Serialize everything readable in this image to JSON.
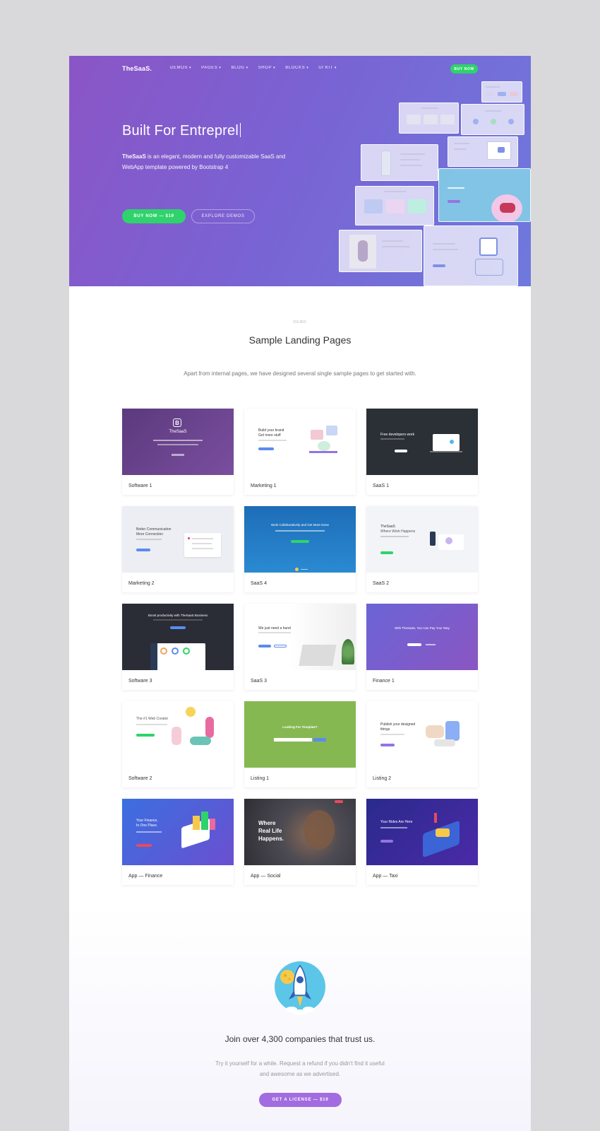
{
  "header": {
    "logo": "TheSaaS.",
    "nav": [
      "DEMOS",
      "PAGES",
      "BLOG",
      "SHOP",
      "BLOCKS",
      "UI KIT"
    ],
    "buy_label": "BUY NOW"
  },
  "hero": {
    "title": "Built For  Entreprel",
    "brand": "TheSaaS",
    "description": " is an elegant, modern and fully customizable SaaS and WebApp template powered by Bootstrap 4",
    "buy_button": "BUY NOW — $19",
    "explore_button": "EXPLORE DEMOS"
  },
  "section": {
    "eyebrow": "DEMO",
    "title": "Sample Landing Pages",
    "description": "Apart from internal pages, we have designed several single sample pages to get started with."
  },
  "cards": [
    {
      "label": "Software 1"
    },
    {
      "label": "Marketing 1"
    },
    {
      "label": "SaaS 1"
    },
    {
      "label": "Marketing 2"
    },
    {
      "label": "SaaS 4"
    },
    {
      "label": "SaaS 2"
    },
    {
      "label": "Software 3"
    },
    {
      "label": "SaaS 3"
    },
    {
      "label": "Finance 1"
    },
    {
      "label": "Software 2"
    },
    {
      "label": "Listing 1"
    },
    {
      "label": "Listing 2"
    },
    {
      "label": "App — Finance"
    },
    {
      "label": "App — Social"
    },
    {
      "label": "App — Taxi"
    }
  ],
  "thumb_text": {
    "software1_title": "TheSaaS",
    "marketing1_title": "Build your brand",
    "marketing1_sub": "Get more stuff",
    "saas1_title": "Free developers work",
    "marketing2_title": "Better Communication",
    "marketing2_sub": "More Connection",
    "saas4_title": "Work Collaboratively and Get More Done",
    "saas2_title": "TheSaaS",
    "saas2_sub": "Where Work Happens",
    "software3_title": "Boost productivity with TheSaaS Business",
    "saas3_title": "We just need a hand",
    "finance1_title": "With TheSaaS, You Can Pay Your Way",
    "software2_title": "The #1 Web Creator",
    "listing1_title": "Looking For Template?",
    "listing2_title": "Publish your designed",
    "listing2_sub": "things",
    "appfin_title": "Your Finance,",
    "appfin_sub": "In One Place.",
    "appsocial_l1": "Where",
    "appsocial_l2": "Real Life",
    "appsocial_l3": "Happens.",
    "apptaxi_title": "Your Rides Are Here"
  },
  "cta": {
    "title": "Join over 4,300 companies that trust us.",
    "description": "Try it yourself for a while. Request a refund if you didn't find it useful and awesome as we advertised.",
    "button": "GET A LICENSE — $19"
  },
  "colors": {
    "hero_start": "#8b55c6",
    "hero_end": "#6f79dd",
    "accent_green": "#2fd36b",
    "accent_purple": "#a26ce0"
  }
}
